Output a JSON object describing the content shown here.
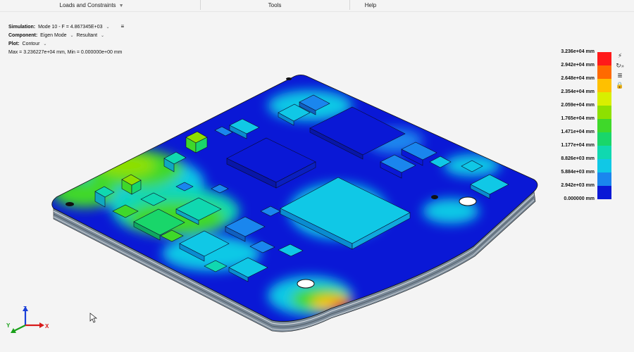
{
  "menu": {
    "items": [
      {
        "label": "Loads and Constraints",
        "has_dropdown": true
      },
      {
        "label": "Tools",
        "has_dropdown": false
      },
      {
        "label": "Help",
        "has_dropdown": false
      }
    ]
  },
  "info": {
    "simulation_label": "Simulation:",
    "simulation_value": "Mode 10 - F = 4.867345E+03",
    "component_label": "Component:",
    "component_value": "Eigen Mode",
    "component_value2": "Resultant",
    "plot_label": "Plot:",
    "plot_value": "Contour",
    "maxmin": "Max = 3.236227e+04 mm, Min = 0.000000e+00 mm"
  },
  "legend": {
    "entries": [
      {
        "label": "3.236e+04 mm",
        "color": "#ff1a1a"
      },
      {
        "label": "2.942e+04 mm",
        "color": "#ff6a00"
      },
      {
        "label": "2.648e+04 mm",
        "color": "#ffc000"
      },
      {
        "label": "2.354e+04 mm",
        "color": "#d8ef00"
      },
      {
        "label": "2.059e+04 mm",
        "color": "#8ee000"
      },
      {
        "label": "1.765e+04 mm",
        "color": "#3fd82a"
      },
      {
        "label": "1.471e+04 mm",
        "color": "#19d66a"
      },
      {
        "label": "1.177e+04 mm",
        "color": "#10d8b0"
      },
      {
        "label": "8.826e+03 mm",
        "color": "#10c8e6"
      },
      {
        "label": "5.884e+03 mm",
        "color": "#1a86ee"
      },
      {
        "label": "2.942e+03 mm",
        "color": "#1a3ff0"
      },
      {
        "label": "0.000000 mm",
        "color": "#0a18d6"
      }
    ]
  },
  "tools": {
    "icons": [
      "lightning-icon",
      "rotate-icon",
      "collapse-icon",
      "list-icon",
      "lock-icon"
    ]
  },
  "triad": {
    "x": "X",
    "y": "Y",
    "z": "Z"
  },
  "colors": {
    "blue": "#0a18d6",
    "cyan": "#10c8e6",
    "green": "#3fd82a",
    "red": "#ff1a1a"
  }
}
